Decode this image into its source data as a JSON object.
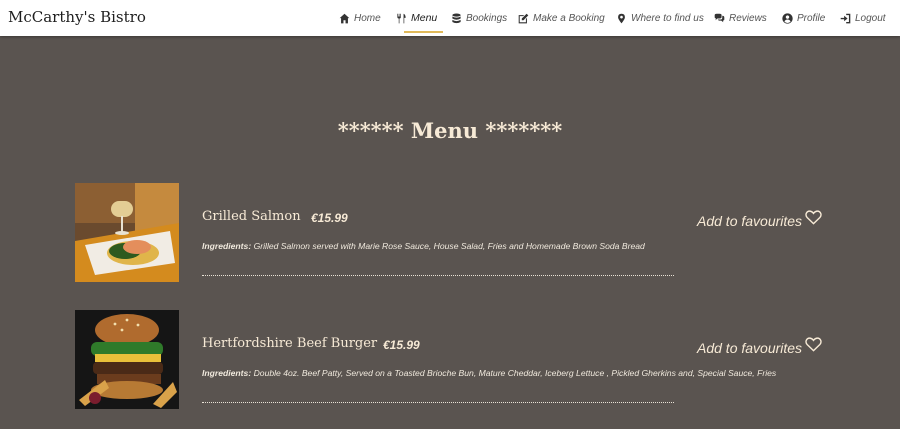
{
  "brand": "McCarthy's Bistro",
  "nav": {
    "home": "Home",
    "menu": "Menu",
    "bookings": "Bookings",
    "make_booking": "Make a Booking",
    "find_us": "Where to find us",
    "reviews": "Reviews",
    "profile": "Profile",
    "logout": "Logout"
  },
  "colors": {
    "background": "#5a5450",
    "navbar": "#ffffff",
    "active_underline": "#e0b95a",
    "text": "#f7ead6"
  },
  "page_heading": "****** Menu *******",
  "items": [
    {
      "name": "Grilled Salmon",
      "price": "€15.99",
      "ingredients_label": "Ingredients:",
      "ingredients": "Grilled Salmon served with Marie Rose Sauce, House Salad, Fries and Homemade Brown Soda Bread",
      "favourite_label": "Add to favourites",
      "image": "grilled-salmon-photo"
    },
    {
      "name": "Hertfordshire Beef Burger",
      "price": "€15.99",
      "ingredients_label": "Ingredients:",
      "ingredients": "Double 4oz. Beef Patty, Served on a Toasted Brioche Bun, Mature Cheddar, Iceberg Lettuce , Pickled Gherkins and, Special Sauce, Fries",
      "favourite_label": "Add to favourites",
      "image": "beef-burger-photo"
    }
  ],
  "icons": [
    "home-icon",
    "utensils-icon",
    "database-icon",
    "edit-icon",
    "map-marker-icon",
    "comments-icon",
    "user-circle-icon",
    "sign-out-icon",
    "heart-icon"
  ]
}
